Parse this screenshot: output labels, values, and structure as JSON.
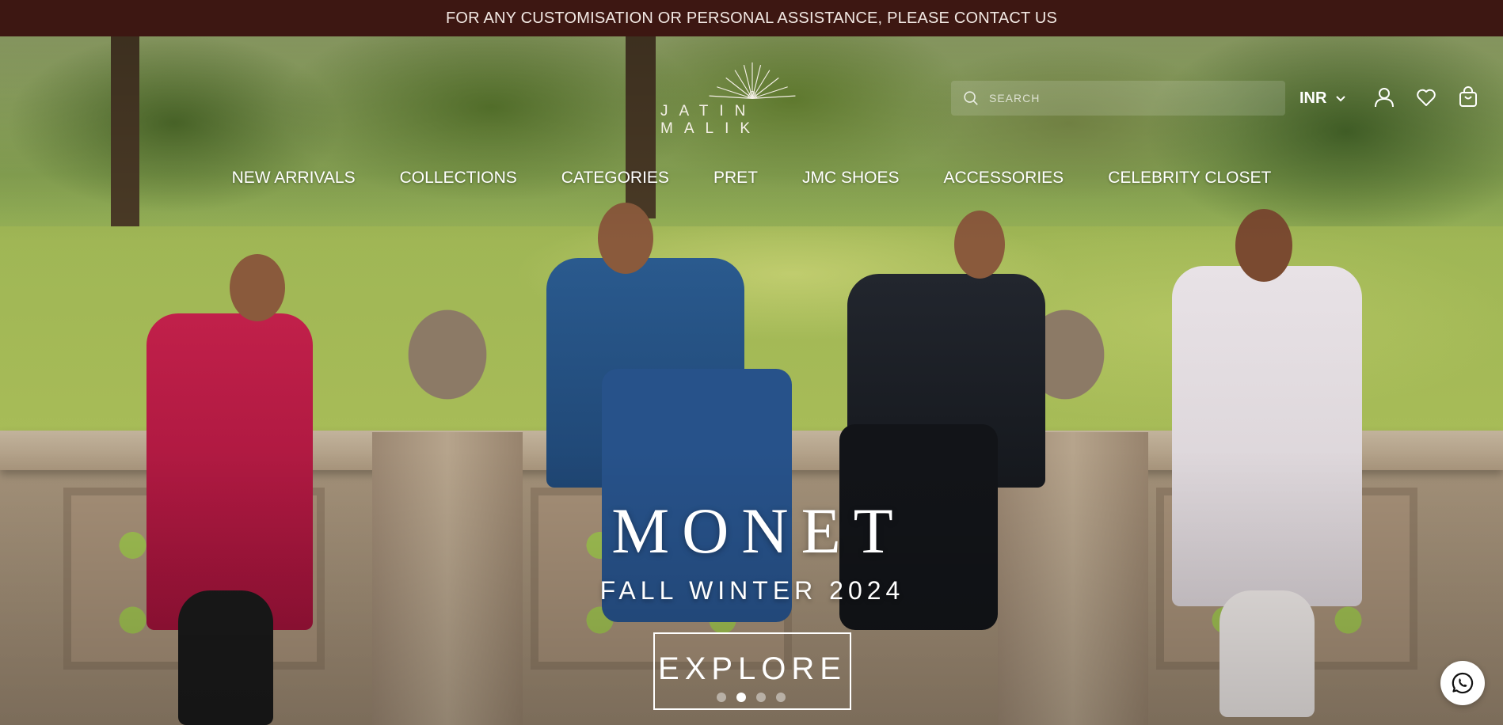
{
  "announcement": {
    "text": "FOR ANY CUSTOMISATION OR PERSONAL ASSISTANCE, PLEASE CONTACT US"
  },
  "brand": {
    "logo_text": "JATIN MALIK"
  },
  "search": {
    "placeholder": "SEARCH"
  },
  "currency": {
    "selected": "INR"
  },
  "nav": {
    "items": [
      "NEW ARRIVALS",
      "COLLECTIONS",
      "CATEGORIES",
      "PRET",
      "JMC SHOES",
      "ACCESSORIES",
      "CELEBRITY CLOSET"
    ]
  },
  "hero": {
    "title": "MONET",
    "subtitle": "FALL WINTER 2024",
    "cta_label": "EXPLORE",
    "slides_total": 4,
    "active_slide": 2
  },
  "icons": {
    "search": "search-icon",
    "currency_dropdown": "chevron-down-icon",
    "account": "user-icon",
    "wishlist": "heart-icon",
    "cart": "shopping-bag-icon",
    "chat": "whatsapp-icon"
  },
  "colors": {
    "announcement_bg": "#3d1712",
    "text_on_hero": "#ffffff"
  }
}
